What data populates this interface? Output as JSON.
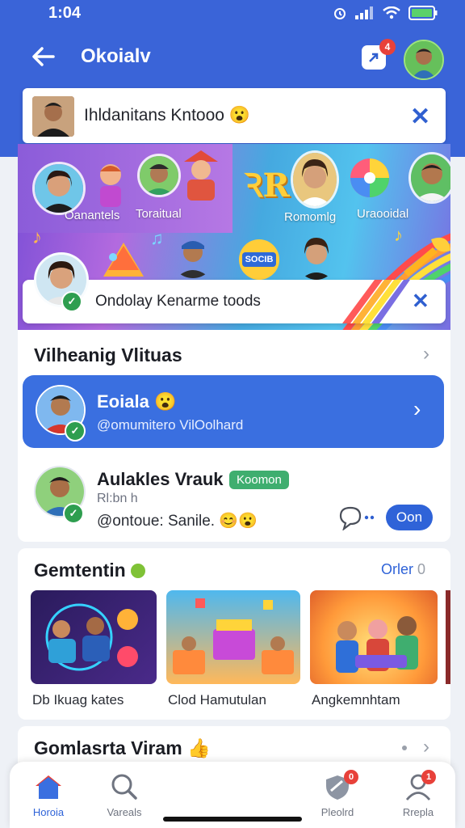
{
  "status_bar": {
    "time": "1:04"
  },
  "header": {
    "title": "Okoialv",
    "badge": "4"
  },
  "search": {
    "value": "Ihldanitans Kntooo"
  },
  "banner": {
    "labels": [
      "Oanantels",
      "Toraitual",
      "Romomlg",
      "Uraooidal"
    ],
    "sign_text": "SOCIB",
    "subbar_text": "Ondolay Kenarme toods"
  },
  "section1": {
    "title": "Vilheanig Vlituas",
    "featured": {
      "name": "Eoiala",
      "sub": "@omumitero VilOolhard"
    },
    "item": {
      "name": "Aulakles Vrauk",
      "tag": "Koomon",
      "line2": "Rl:bn h",
      "line3": "@ontoue: Sanile.",
      "follow_label": "Oon"
    }
  },
  "section2": {
    "title": "Gemtentin",
    "action": "Orler",
    "action_suffix": "0",
    "thumbs": [
      {
        "label": "Db Ikuag kates"
      },
      {
        "label": "Clod Hamutulan"
      },
      {
        "label": "Angkemnhtam"
      }
    ]
  },
  "section3": {
    "title": "Gomlasrta Viram"
  },
  "nav": {
    "items": [
      {
        "label": "Horoia"
      },
      {
        "label": "Vareals"
      },
      {
        "label": "Pleolrd",
        "badge": "0"
      },
      {
        "label": "Rrepla",
        "badge": "1"
      }
    ]
  },
  "colors": {
    "primary": "#3a64d8",
    "accent_green": "#3fae6f",
    "badge_red": "#e8413a"
  }
}
